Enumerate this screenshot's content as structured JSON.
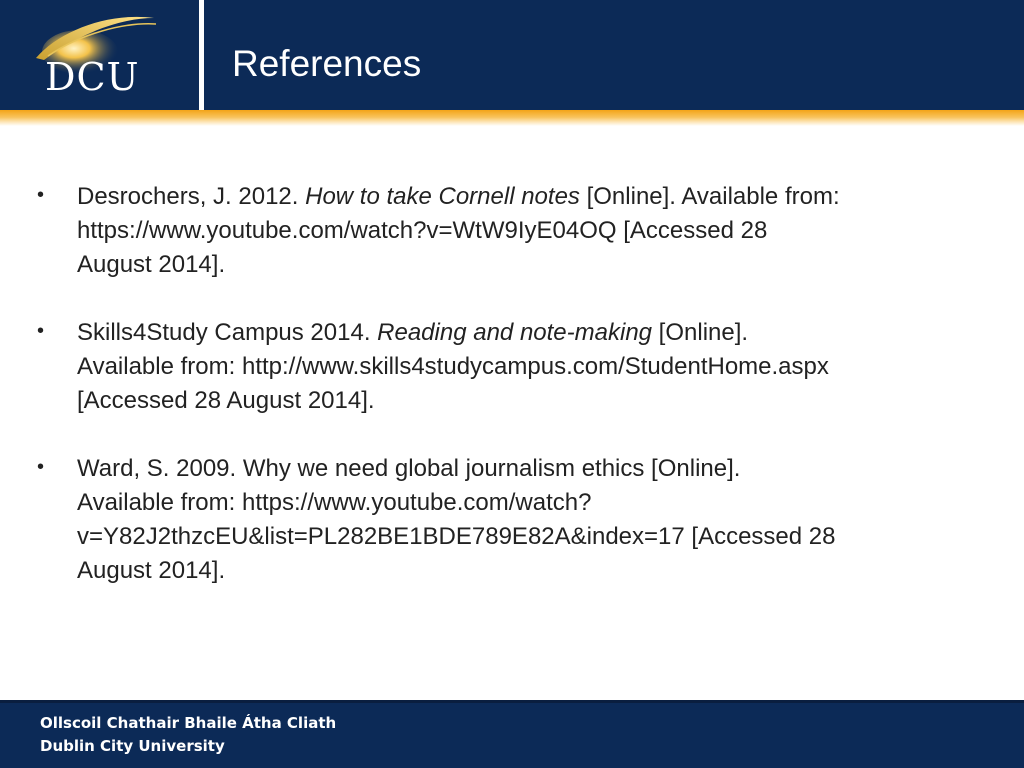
{
  "header": {
    "logo_text": "DCU",
    "title": "References"
  },
  "references": [
    {
      "lines": [
        [
          "Desrochers, J. 2012. ",
          "How to take Cornell notes",
          " [Online]. Available from:"
        ],
        [
          "https://www.youtube.com/watch?v=WtW9IyE04OQ [Accessed 28"
        ],
        [
          "August 2014]."
        ]
      ]
    },
    {
      "lines": [
        [
          "Skills4Study Campus 2014. ",
          "Reading and note-making",
          " [Online]."
        ],
        [
          "Available from: http://www.skills4studycampus.com/StudentHome.aspx"
        ],
        [
          "[Accessed 28 August 2014]."
        ]
      ]
    },
    {
      "lines": [
        [
          "Ward, S. 2009. Why we need global journalism ethics [Online]."
        ],
        [
          "Available from: https://www.youtube.com/watch?"
        ],
        [
          "v=Y82J2thzcEU&list=PL282BE1BDE789E82A&index=17 [Accessed 28"
        ],
        [
          "August 2014]."
        ]
      ]
    }
  ],
  "footer": {
    "line1": "Ollscoil Chathair Bhaile Átha Cliath",
    "line2": "Dublin City University"
  },
  "colors": {
    "navy": "#0c2a57",
    "gold": "#f3a417"
  }
}
